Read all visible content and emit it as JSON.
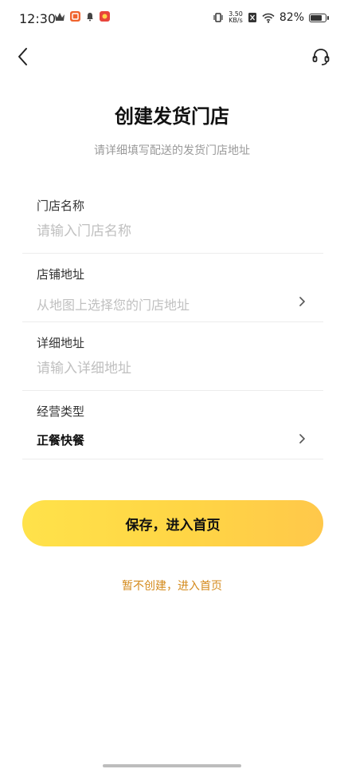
{
  "status_bar": {
    "time": "12:30",
    "net_speed_value": "3.50",
    "net_speed_unit": "KB/s",
    "battery_percent": "82%",
    "battery_level": 0.82,
    "icons": [
      "crown-icon",
      "app-notification-icon",
      "bell-icon",
      "app-notification-icon-2",
      "vibrate-icon",
      "sim-icon",
      "wifi-icon",
      "battery-icon"
    ]
  },
  "nav": {
    "back_icon": "chevron-left-icon",
    "service_icon": "headset-icon"
  },
  "header": {
    "title": "创建发货门店",
    "subtitle": "请详细填写配送的发货门店地址"
  },
  "form": {
    "store_name": {
      "label": "门店名称",
      "placeholder": "请输入门店名称",
      "value": ""
    },
    "store_address": {
      "label": "店铺地址",
      "placeholder": "从地图上选择您的门店地址"
    },
    "detail_address": {
      "label": "详细地址",
      "placeholder": "请输入详细地址",
      "value": ""
    },
    "business_type": {
      "label": "经营类型",
      "value": "正餐快餐"
    }
  },
  "actions": {
    "save_label": "保存，进入首页",
    "skip_label": "暂不创建，进入首页"
  },
  "colors": {
    "accent_start": "#ffe24a",
    "accent_end": "#ffc84a",
    "skip_link": "#d48a1c",
    "placeholder": "#c0c0c0"
  }
}
